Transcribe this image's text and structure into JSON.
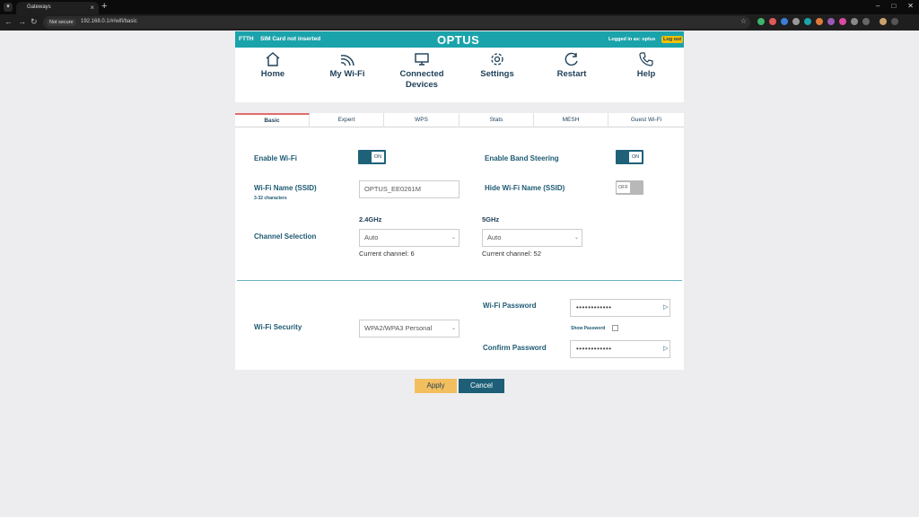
{
  "browser": {
    "tab_title": "Gateways",
    "security_label": "Not secure",
    "url": "192.168.0.1/#/wifi/basic"
  },
  "header": {
    "connection_type": "FTTH",
    "sim_status": "SIM Card not inserted",
    "logo": "OPTUS",
    "logged_in": "Logged in as: optus",
    "logout": "Log out",
    "nav": [
      {
        "label": "Home",
        "icon": "home-icon"
      },
      {
        "label": "My Wi-Fi",
        "icon": "wifi-icon"
      },
      {
        "label": "Connected Devices",
        "label_line1": "Connected",
        "label_line2": "Devices",
        "icon": "monitor-icon"
      },
      {
        "label": "Settings",
        "icon": "gear-icon"
      },
      {
        "label": "Restart",
        "icon": "restart-icon"
      },
      {
        "label": "Help",
        "icon": "phone-icon"
      }
    ],
    "active_nav": "My Wi-Fi"
  },
  "tabs": [
    "Basic",
    "Expert",
    "WPS",
    "Stats",
    "MESH",
    "Guest Wi-Fi"
  ],
  "active_tab": "Basic",
  "form": {
    "enable_wifi": {
      "label": "Enable Wi-Fi",
      "state": "ON"
    },
    "band_steering": {
      "label": "Enable Band Steering",
      "state": "ON"
    },
    "ssid": {
      "label": "Wi-Fi Name (SSID)",
      "hint": "3-32 characters",
      "value": "OPTUS_EE0261M"
    },
    "hide_ssid": {
      "label": "Hide Wi-Fi Name (SSID)",
      "state": "OFF"
    },
    "channel": {
      "label": "Channel Selection",
      "band_24": {
        "title": "2.4GHz",
        "value": "Auto",
        "current": "Current channel: 6"
      },
      "band_5": {
        "title": "5GHz",
        "value": "Auto",
        "current": "Current channel: 52"
      }
    },
    "security": {
      "label": "Wi-Fi Security",
      "value": "WPA2/WPA3 Personal"
    },
    "password": {
      "label": "Wi-Fi Password",
      "masked": "••••••••••••"
    },
    "show_password": "Show Password",
    "confirm_password": {
      "label": "Confirm Password",
      "masked": "••••••••••••"
    }
  },
  "actions": {
    "apply": "Apply",
    "cancel": "Cancel"
  },
  "colors": {
    "brand_teal": "#1ba3ab",
    "dark_blue": "#1e5f77",
    "apply_yellow": "#f3bf5e",
    "active_tab_accent": "#e46b6b"
  }
}
